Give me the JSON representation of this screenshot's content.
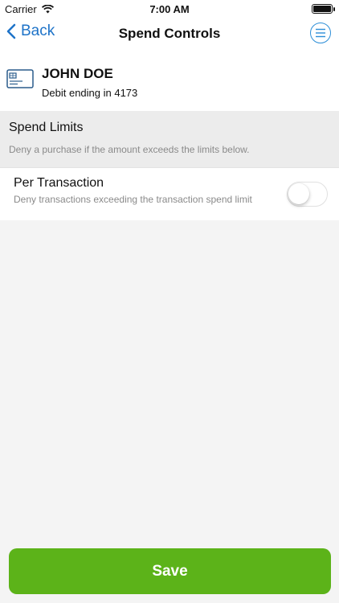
{
  "status_bar": {
    "carrier": "Carrier",
    "time": "7:00 AM",
    "wifi_icon": "wifi-icon",
    "battery_icon": "battery-icon"
  },
  "nav": {
    "back_label": "Back",
    "title": "Spend Controls",
    "menu_icon": "menu-icon",
    "accent_color": "#1e73c8"
  },
  "card": {
    "name": "JOHN DOE",
    "subtitle": "Debit ending in 4173",
    "icon": "card-icon"
  },
  "section": {
    "title": "Spend Limits",
    "description": "Deny a purchase if the amount exceeds the limits below."
  },
  "per_transaction": {
    "title": "Per Transaction",
    "description": "Deny transactions exceeding the transaction spend limit",
    "toggle_on": false
  },
  "actions": {
    "save_label": "Save",
    "save_color": "#5cb319"
  }
}
